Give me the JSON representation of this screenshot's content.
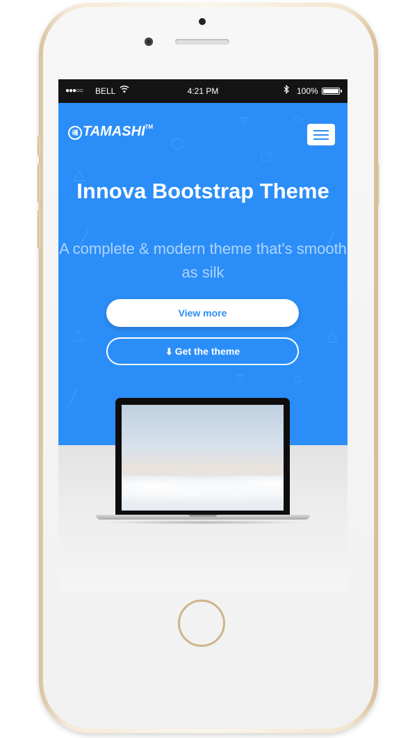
{
  "status_bar": {
    "signal": "●●●○○",
    "carrier": "BELL",
    "time": "4:21 PM",
    "battery_pct": "100%",
    "battery_level": 1.0
  },
  "nav": {
    "brand": "TAMASHI",
    "brand_mark": "魂",
    "trademark": "TM",
    "menu_icon": "hamburger-icon"
  },
  "hero": {
    "title": "Innova Bootstrap Theme",
    "subtitle": "A complete & modern theme that's smooth as silk",
    "view_more_label": "View more",
    "get_theme_label": "Get the theme",
    "download_icon": "download-icon"
  },
  "colors": {
    "brand_blue": "#2b8ef8",
    "white": "#ffffff",
    "phone_gold": "#e9d9b8"
  }
}
